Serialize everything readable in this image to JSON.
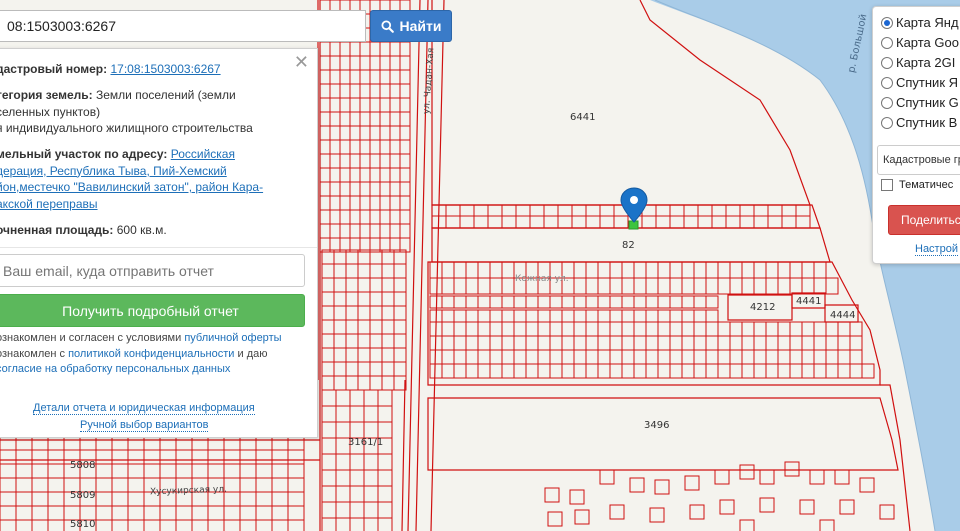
{
  "search": {
    "value": "08:1503003:6267",
    "button_label": "Найти",
    "icon": "search-icon"
  },
  "info_panel": {
    "cadastral_label": "дастровый номер:",
    "cadastral_value": "17:08:1503003:6267",
    "category_label": "тегория земель:",
    "category_value_line1": "Земли поселений (земли",
    "category_value_line2": "селенных пунктов)",
    "category_value_line3": "я индивидуального жилищного строительства",
    "address_label": "мельный участок по адресу:",
    "address_link_line1": "Российская",
    "address_link_line2": "дерация, Республика Тыва, Пий-Хемский",
    "address_link_line3": "йон,местечко \"Вавилинский затон\", район Кара-",
    "address_link_line4": "акской переправы",
    "area_label": "очненная площадь:",
    "area_value": "600 кв.м.",
    "email_placeholder": "Ваш email, куда отправить отчет",
    "report_button": "Получить подробный отчет",
    "consent1_text": "ознакомлен и согласен с условиями",
    "consent1_link": "публичной оферты",
    "consent2_text": "ознакомлен с",
    "consent2_link": "политикой конфиденциальности",
    "consent2_tail": "и даю",
    "consent3_link": "согласие на обработку персональных данных",
    "details_link": "Детали отчета и юридическая информация",
    "manual_link": "Ручной выбор вариантов",
    "close_icon": "close-icon"
  },
  "layers": {
    "options": [
      {
        "label": "Карта Янд",
        "selected": true
      },
      {
        "label": "Карта Goo",
        "selected": false
      },
      {
        "label": "Карта 2GI",
        "selected": false
      },
      {
        "label": "Спутник Я",
        "selected": false
      },
      {
        "label": "Спутник G",
        "selected": false
      },
      {
        "label": "Спутник B",
        "selected": false
      }
    ],
    "select_value": "Кадастровые гр",
    "thematic_label": "Тематичес",
    "share_button": "Поделиться",
    "settings_link": "Настрой"
  },
  "map": {
    "parcel_labels": {
      "p6441": "6441",
      "p82": "82",
      "p4212": "4212",
      "p4441": "4441",
      "p4444": "4444",
      "p3496": "3496",
      "p3161": "3161/1",
      "p5808": "5808",
      "p5809": "5809",
      "p5810": "5810"
    },
    "street_chadan": "ул. Чадан-Хая",
    "street_mid": "Кожная ул.",
    "street_bottom": "Хусукирская ул.",
    "river_label": "р. Большой",
    "marker_icon": "map-pin-icon",
    "colors": {
      "parcel_line": "#d01010",
      "river": "#a9cce8",
      "background": "#f4f3ee",
      "marker": "#1a73c8"
    }
  }
}
